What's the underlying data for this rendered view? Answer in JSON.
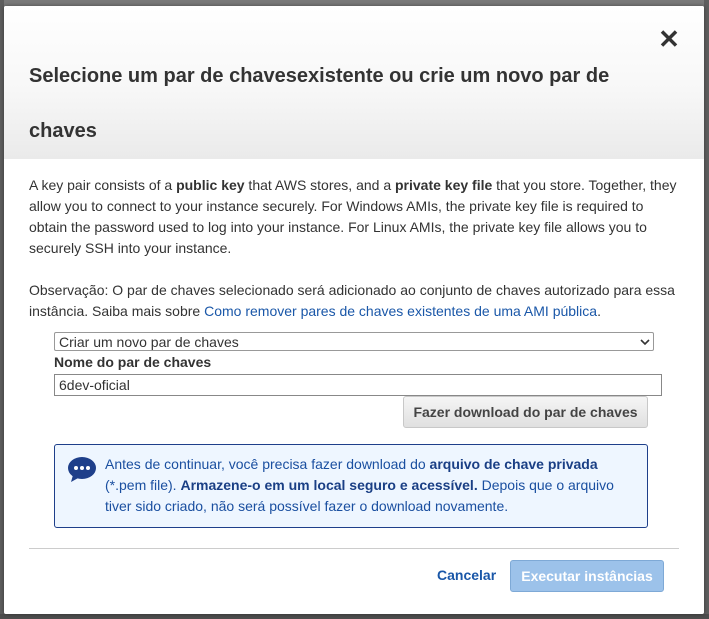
{
  "dialog": {
    "title": "Selecione um par de chavesexistente ou crie um novo par de chaves",
    "close_symbol": "✕"
  },
  "description": {
    "segments": [
      {
        "text": "A key pair consists of a ",
        "bold": false
      },
      {
        "text": "public key",
        "bold": true
      },
      {
        "text": " that AWS stores, and a ",
        "bold": false
      },
      {
        "text": "private key file",
        "bold": true
      },
      {
        "text": " that you store. Together, they allow you to connect to your instance securely. For Windows AMIs, the private key file is required to obtain the password used to log into your instance. For Linux AMIs, the private key file allows you to securely SSH into your instance.",
        "bold": false
      }
    ]
  },
  "note": {
    "text": "Observação: O par de chaves selecionado será adicionado ao conjunto de chaves autorizado para essa instância. Saiba mais sobre ",
    "link_text": "Como remover pares de chaves existentes de uma AMI pública",
    "suffix": "."
  },
  "keypair_select": {
    "selected": "Criar um novo par de chaves"
  },
  "keypair_name": {
    "label": "Nome do par de chaves",
    "value": "6dev-oficial"
  },
  "download_button": "Fazer download do par de chaves",
  "info": {
    "icon": "speech-bubble-icon",
    "text_1": "Antes de continuar, você precisa fazer download do ",
    "bold_1": "arquivo de chave privada",
    "text_2": " (*.pem file). ",
    "bold_2": "Armazene-o em um local seguro e acessível.",
    "text_3": " Depois que o arquivo tiver sido criado, não será possível fazer o download novamente."
  },
  "footer": {
    "cancel": "Cancelar",
    "launch": "Executar instâncias"
  },
  "colors": {
    "link": "#1a57a8",
    "info_bg": "#eef6ff",
    "info_border": "#1e3f8a",
    "launch_disabled": "#9cc2ea"
  }
}
